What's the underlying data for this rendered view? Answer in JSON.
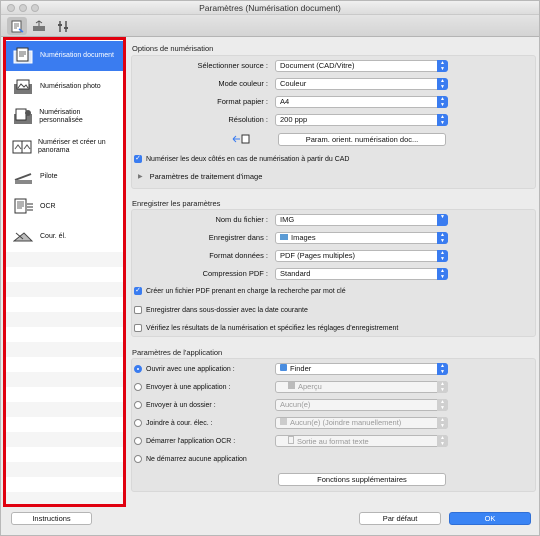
{
  "window": {
    "title": "Paramètres (Numérisation document)"
  },
  "toolbar": {
    "icons": [
      "scan-from-computer-icon",
      "scan-from-panel-icon",
      "general-settings-icon"
    ]
  },
  "sidebar": {
    "items": [
      {
        "label": "Numérisation document",
        "icon": "document-scan-icon",
        "selected": true
      },
      {
        "label": "Numérisation photo",
        "icon": "photo-scan-icon"
      },
      {
        "label": "Numérisation personnalisée",
        "icon": "custom-scan-icon"
      },
      {
        "label": "Numériser et créer un panorama",
        "icon": "panorama-icon"
      },
      {
        "label": "Pilote",
        "icon": "driver-icon"
      },
      {
        "label": "OCR",
        "icon": "ocr-icon"
      },
      {
        "label": "Cour. él.",
        "icon": "email-icon"
      }
    ]
  },
  "scan_options": {
    "header": "Options de numérisation",
    "source_label": "Sélectionner source :",
    "source_value": "Document (CAD/Vitre)",
    "color_label": "Mode couleur :",
    "color_value": "Couleur",
    "paper_label": "Format papier :",
    "paper_value": "A4",
    "resolution_label": "Résolution :",
    "resolution_value": "200 ppp",
    "orientation_button": "Param. orient. numérisation doc...",
    "duplex_label": "Numériser les deux côtés en cas de numérisation à partir du CAD",
    "image_processing_label": "Paramètres de traitement d'image"
  },
  "save_settings": {
    "header": "Enregistrer les paramètres",
    "filename_label": "Nom du fichier :",
    "filename_value": "IMG",
    "save_in_label": "Enregistrer dans :",
    "save_in_value": "Images",
    "format_label": "Format données :",
    "format_value": "PDF (Pages multiples)",
    "compression_label": "Compression PDF :",
    "compression_value": "Standard",
    "keyword_pdf_label": "Créer un fichier PDF prenant en charge la recherche par mot clé",
    "subfolder_label": "Enregistrer dans sous-dossier avec la date courante",
    "verify_label": "Vérifiez les résultats de la numérisation et spécifiez les réglages d'enregistrement"
  },
  "app_settings": {
    "header": "Paramètres de l'application",
    "open_with_label": "Ouvrir avec une application :",
    "open_with_value": "Finder",
    "send_app_label": "Envoyer à une application :",
    "send_app_value": "Aperçu",
    "send_folder_label": "Envoyer à un dossier :",
    "send_folder_value": "Aucun(e)",
    "email_label": "Joindre à cour. élec. :",
    "email_value": "Aucun(e) (Joindre manuellement)",
    "ocr_label": "Démarrer l'application OCR :",
    "ocr_value": "Sortie au format texte",
    "none_label": "Ne démarrez aucune application",
    "more_button": "Fonctions supplémentaires"
  },
  "footer": {
    "instructions": "Instructions",
    "default": "Par défaut",
    "ok": "OK"
  },
  "colors": {
    "accent": "#3a7cf0",
    "highlight": "#e0000f"
  }
}
